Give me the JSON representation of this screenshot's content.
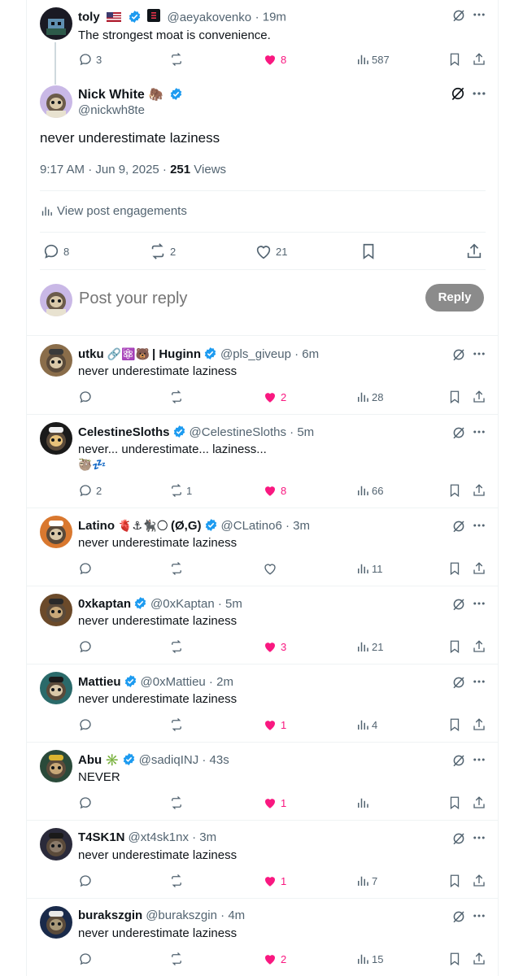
{
  "parent": {
    "name": "toly",
    "handle": "@aeyakovenko",
    "time": "19m",
    "text": "The strongest moat is convenience.",
    "replies": "3",
    "reposts": "",
    "likes": "8",
    "views": "587"
  },
  "main": {
    "name": "Nick White",
    "handle": "@nickwh8te",
    "text": "never underestimate laziness",
    "timestamp": "9:17 AM · Jun 9, 2025 · ",
    "views_count": "251",
    "views_label": " Views",
    "engagements": "View post engagements",
    "replies": "8",
    "reposts": "2",
    "likes": "21"
  },
  "compose": {
    "placeholder": "Post your reply",
    "button": "Reply"
  },
  "replies": [
    {
      "name": "utku",
      "emojis": "🔗⚛️🐻",
      "suffix": "| Huginn",
      "handle": "@pls_giveup",
      "time": "6m",
      "text": "never underestimate laziness",
      "text2": "",
      "replies": "",
      "reposts": "",
      "likes": "2",
      "liked": true,
      "views": "28",
      "verified": true,
      "avatar": "sloth-hat"
    },
    {
      "name": "CelestineSloths",
      "emojis": "",
      "suffix": "",
      "handle": "@CelestineSloths",
      "time": "5m",
      "text": "never... underestimate... laziness...",
      "text2": "🦥💤",
      "replies": "2",
      "reposts": "1",
      "likes": "8",
      "liked": true,
      "views": "66",
      "verified": true,
      "avatar": "society"
    },
    {
      "name": "Latino",
      "emojis": "🫀⚓🐈‍⬛🌕",
      "suffix": "(Ø,G)",
      "handle": "@CLatino6",
      "time": "3m",
      "text": "never underestimate laziness",
      "text2": "",
      "replies": "",
      "reposts": "",
      "likes": "",
      "liked": false,
      "views": "11",
      "verified": true,
      "avatar": "sloth-orange"
    },
    {
      "name": "0xkaptan",
      "emojis": "",
      "suffix": "",
      "handle": "@0xKaptan",
      "time": "5m",
      "text": "never underestimate laziness",
      "text2": "",
      "replies": "",
      "reposts": "",
      "likes": "3",
      "liked": true,
      "views": "21",
      "verified": true,
      "avatar": "sloth-brown"
    },
    {
      "name": "Mattieu",
      "emojis": "",
      "suffix": "",
      "handle": "@0xMattieu",
      "time": "2m",
      "text": "never underestimate laziness",
      "text2": "",
      "replies": "",
      "reposts": "",
      "likes": "1",
      "liked": true,
      "views": "4",
      "verified": true,
      "avatar": "sloth-teal"
    },
    {
      "name": "Abu",
      "emojis": "✳️",
      "suffix": "",
      "handle": "@sadiqINJ",
      "time": "43s",
      "text": "NEVER",
      "text2": "",
      "replies": "",
      "reposts": "",
      "likes": "1",
      "liked": true,
      "views": "",
      "verified": true,
      "avatar": "sloth-green"
    },
    {
      "name": "T4SK1N",
      "emojis": "",
      "suffix": "",
      "handle": "@xt4sk1nx",
      "time": "3m",
      "text": "never underestimate laziness",
      "text2": "",
      "replies": "",
      "reposts": "",
      "likes": "1",
      "liked": true,
      "views": "7",
      "verified": false,
      "avatar": "sloth-dark"
    },
    {
      "name": "burakszgin",
      "emojis": "",
      "suffix": "",
      "handle": "@burakszgin",
      "time": "4m",
      "text": "never underestimate laziness",
      "text2": "",
      "replies": "",
      "reposts": "",
      "likes": "2",
      "liked": true,
      "views": "15",
      "verified": false,
      "avatar": "sloth-navy"
    }
  ],
  "colors": {
    "accent": "#1d9bf0",
    "like": "#f91880",
    "muted": "#536471",
    "reply_button": "#8b8b8b"
  },
  "icons": [
    "reply-icon",
    "repost-icon",
    "heart-icon",
    "views-icon",
    "bookmark-icon",
    "share-icon",
    "grok-icon",
    "more-icon",
    "verified-icon",
    "engagements-icon"
  ]
}
